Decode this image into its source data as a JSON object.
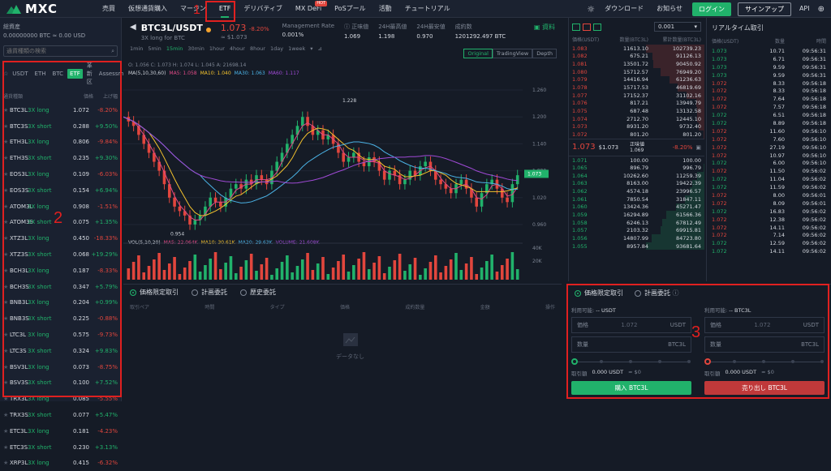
{
  "nav": {
    "logo": "MXC",
    "items": [
      "売買",
      "仮想通貨購入",
      "マージン",
      "ETF",
      "デリバティブ",
      "MX DeFi",
      "PoSプール",
      "活動",
      "チュートリアル"
    ],
    "hot_badge": "HOT",
    "download": "ダウンロード",
    "notice": "お知らせ",
    "login": "ログイン",
    "signup": "サインアップ",
    "api": "API"
  },
  "annotations": [
    "1",
    "2",
    "3"
  ],
  "left": {
    "account_title": "総資産",
    "account_value": "0.00000000 BTC ≈ 0.00 USD",
    "search_placeholder": "通貨種類の検索",
    "tabs": [
      "USDT",
      "ETH",
      "BTC",
      "ETF",
      "革新区",
      "Assessment"
    ],
    "col_pair": "通貨種類",
    "col_price": "価格",
    "col_change": "上げ幅",
    "coins": [
      {
        "name": "BTC3L",
        "tag": "3X long",
        "price": "1.072",
        "change": "-8.20%"
      },
      {
        "name": "BTC3S",
        "tag": "3X short",
        "price": "0.288",
        "change": "+9.50%"
      },
      {
        "name": "ETH3L",
        "tag": "3X long",
        "price": "0.806",
        "change": "-9.84%"
      },
      {
        "name": "ETH3S",
        "tag": "3X short",
        "price": "0.235",
        "change": "+9.30%"
      },
      {
        "name": "EOS3L",
        "tag": "3X long",
        "price": "0.109",
        "change": "-6.03%"
      },
      {
        "name": "EOS3S",
        "tag": "3X short",
        "price": "0.154",
        "change": "+6.94%"
      },
      {
        "name": "ATOM3L",
        "tag": "3X long",
        "price": "0.908",
        "change": "-1.51%"
      },
      {
        "name": "ATOM3S",
        "tag": "3X short",
        "price": "0.075",
        "change": "+1.35%"
      },
      {
        "name": "XTZ3L",
        "tag": "3X long",
        "price": "0.450",
        "change": "-18.33%"
      },
      {
        "name": "XTZ3S",
        "tag": "3X short",
        "price": "0.068",
        "change": "+19.29%"
      },
      {
        "name": "BCH3L",
        "tag": "3X long",
        "price": "0.187",
        "change": "-8.33%"
      },
      {
        "name": "BCH3S",
        "tag": "3X short",
        "price": "0.347",
        "change": "+5.79%"
      },
      {
        "name": "BNB3L",
        "tag": "3X long",
        "price": "0.204",
        "change": "+0.99%"
      },
      {
        "name": "BNB3S",
        "tag": "3X short",
        "price": "0.225",
        "change": "-0.88%"
      },
      {
        "name": "LTC3L",
        "tag": "3X long",
        "price": "0.575",
        "change": "-9.73%"
      },
      {
        "name": "LTC3S",
        "tag": "3X short",
        "price": "0.324",
        "change": "+9.83%"
      },
      {
        "name": "BSV3L",
        "tag": "3X long",
        "price": "0.073",
        "change": "-8.75%"
      },
      {
        "name": "BSV3S",
        "tag": "3X short",
        "price": "0.100",
        "change": "+7.52%"
      },
      {
        "name": "TRX3L",
        "tag": "3X long",
        "price": "0.085",
        "change": "-5.55%"
      },
      {
        "name": "TRX3S",
        "tag": "3X short",
        "price": "0.077",
        "change": "+5.47%"
      },
      {
        "name": "ETC3L",
        "tag": "3X long",
        "price": "0.181",
        "change": "-4.23%"
      },
      {
        "name": "ETC3S",
        "tag": "3X short",
        "price": "0.230",
        "change": "+3.13%"
      },
      {
        "name": "XRP3L",
        "tag": "3X long",
        "price": "0.415",
        "change": "-6.32%"
      }
    ]
  },
  "chart": {
    "pair": "BTC3L/USDT",
    "subtitle": "3X long for BTC",
    "price": "1.073",
    "change": "-8.20%",
    "price_usd": "≈ $1.073",
    "stats": [
      {
        "k": "Management Rate",
        "v": "0.001%"
      },
      {
        "k": "ⓘ 正味値",
        "v": "1.069"
      },
      {
        "k": "24H最高値",
        "v": "1.198"
      },
      {
        "k": "24H最安値",
        "v": "0.970"
      },
      {
        "k": "成約数",
        "v": "1201292.497 BTC"
      }
    ],
    "doc_link": "資料",
    "intervals": [
      "1min",
      "5min",
      "15min",
      "30min",
      "1hour",
      "4hour",
      "8hour",
      "1day",
      "1week"
    ],
    "views": [
      "Original",
      "TradingView",
      "Depth"
    ],
    "ohlc": "O: 1.056  C: 1.073  H: 1.074  L: 1.045  A: 21698.14",
    "ma_line": {
      "ma": "MA(5,10,30,60)",
      "ma5": "MA5: 1.058",
      "ma10": "MA10: 1.040",
      "ma30": "MA30: 1.063",
      "ma60": "MA60: 1.117"
    },
    "vol_line": {
      "vol": "VOL(5,10,20)",
      "ma5": "MA5: 22.064K",
      "ma10": "MA10: 30.61K",
      "ma20": "MA20: 29.63K",
      "volume": "VOLUME: 21.608K"
    },
    "y_ticks": [
      "1.260",
      "1.200",
      "1.140",
      "1.080",
      "1.020",
      "0.960"
    ],
    "vol_ticks": [
      "40K",
      "20K"
    ],
    "x_ticks": [
      "04:00",
      "16:00",
      "19:00",
      "01-17",
      "05:00"
    ],
    "high_label": "1.228",
    "low_label": "0.954",
    "last_label": "1.073"
  },
  "orders": {
    "tab_open": "価格限定取引",
    "tab_plan": "計画委託",
    "tab_history": "歴史委託",
    "cols": [
      "取引ペア",
      "時間",
      "タイプ",
      "価格",
      "成約数量",
      "金額",
      "操作"
    ],
    "empty": "データなし"
  },
  "orderbook": {
    "precision": "0.001",
    "cols": [
      "価格(USDT)",
      "数量(BTC3L)",
      "累計数量(BTC3L)"
    ],
    "asks": [
      {
        "p": "1.083",
        "a": "11613.10",
        "t": "102739.23"
      },
      {
        "p": "1.082",
        "a": "675.21",
        "t": "91126.13"
      },
      {
        "p": "1.081",
        "a": "13501.72",
        "t": "90450.92"
      },
      {
        "p": "1.080",
        "a": "15712.57",
        "t": "76949.20"
      },
      {
        "p": "1.079",
        "a": "14416.94",
        "t": "61236.63"
      },
      {
        "p": "1.078",
        "a": "15717.53",
        "t": "46819.69"
      },
      {
        "p": "1.077",
        "a": "17152.37",
        "t": "31102.16"
      },
      {
        "p": "1.076",
        "a": "817.21",
        "t": "13949.79"
      },
      {
        "p": "1.075",
        "a": "687.48",
        "t": "13132.58"
      },
      {
        "p": "1.074",
        "a": "2712.70",
        "t": "12445.10"
      },
      {
        "p": "1.073",
        "a": "8931.20",
        "t": "9732.40"
      },
      {
        "p": "1.072",
        "a": "801.20",
        "t": "801.20"
      }
    ],
    "mid_price": "1.073",
    "mid_usd": "$1.073",
    "mid_label": "正味値",
    "mid_net": "1.069",
    "mid_change": "-8.20%",
    "bids": [
      {
        "p": "1.071",
        "a": "100.00",
        "t": "100.00"
      },
      {
        "p": "1.065",
        "a": "896.79",
        "t": "996.79"
      },
      {
        "p": "1.064",
        "a": "10262.60",
        "t": "11259.39"
      },
      {
        "p": "1.063",
        "a": "8163.00",
        "t": "19422.39"
      },
      {
        "p": "1.062",
        "a": "4574.18",
        "t": "23996.57"
      },
      {
        "p": "1.061",
        "a": "7850.54",
        "t": "31847.11"
      },
      {
        "p": "1.060",
        "a": "13424.36",
        "t": "45271.47"
      },
      {
        "p": "1.059",
        "a": "16294.89",
        "t": "61566.36"
      },
      {
        "p": "1.058",
        "a": "6246.13",
        "t": "67812.49"
      },
      {
        "p": "1.057",
        "a": "2103.32",
        "t": "69915.81"
      },
      {
        "p": "1.056",
        "a": "14807.99",
        "t": "84723.80"
      },
      {
        "p": "1.055",
        "a": "8957.84",
        "t": "93681.64"
      }
    ]
  },
  "trades": {
    "title": "リアルタイム取引",
    "cols": [
      "価格(USDT)",
      "数量",
      "時間"
    ],
    "rows": [
      {
        "p": "1.073",
        "a": "10.71",
        "t": "09:56:31",
        "s": "g"
      },
      {
        "p": "1.073",
        "a": "6.71",
        "t": "09:56:31",
        "s": "g"
      },
      {
        "p": "1.073",
        "a": "9.59",
        "t": "09:56:31",
        "s": "g"
      },
      {
        "p": "1.073",
        "a": "9.59",
        "t": "09:56:31",
        "s": "g"
      },
      {
        "p": "1.072",
        "a": "8.33",
        "t": "09:56:18",
        "s": "r"
      },
      {
        "p": "1.072",
        "a": "8.33",
        "t": "09:56:18",
        "s": "r"
      },
      {
        "p": "1.072",
        "a": "7.64",
        "t": "09:56:18",
        "s": "r"
      },
      {
        "p": "1.072",
        "a": "7.57",
        "t": "09:56:18",
        "s": "r"
      },
      {
        "p": "1.072",
        "a": "6.51",
        "t": "09:56:18",
        "s": "g"
      },
      {
        "p": "1.072",
        "a": "8.89",
        "t": "09:56:18",
        "s": "g"
      },
      {
        "p": "1.072",
        "a": "11.60",
        "t": "09:56:10",
        "s": "r"
      },
      {
        "p": "1.072",
        "a": "7.60",
        "t": "09:56:10",
        "s": "r"
      },
      {
        "p": "1.072",
        "a": "27.19",
        "t": "09:56:10",
        "s": "r"
      },
      {
        "p": "1.072",
        "a": "10.97",
        "t": "09:56:10",
        "s": "r"
      },
      {
        "p": "1.072",
        "a": "6.00",
        "t": "09:56:10",
        "s": "g"
      },
      {
        "p": "1.072",
        "a": "11.50",
        "t": "09:56:02",
        "s": "r"
      },
      {
        "p": "1.072",
        "a": "11.04",
        "t": "09:56:02",
        "s": "g"
      },
      {
        "p": "1.072",
        "a": "11.59",
        "t": "09:56:02",
        "s": "g"
      },
      {
        "p": "1.072",
        "a": "8.00",
        "t": "09:56:01",
        "s": "r"
      },
      {
        "p": "1.072",
        "a": "8.09",
        "t": "09:56:01",
        "s": "r"
      },
      {
        "p": "1.072",
        "a": "16.83",
        "t": "09:56:02",
        "s": "g"
      },
      {
        "p": "1.072",
        "a": "12.38",
        "t": "09:56:02",
        "s": "r"
      },
      {
        "p": "1.072",
        "a": "14.11",
        "t": "09:56:02",
        "s": "r"
      },
      {
        "p": "1.072",
        "a": "7.14",
        "t": "09:56:02",
        "s": "r"
      },
      {
        "p": "1.072",
        "a": "12.59",
        "t": "09:56:02",
        "s": "g"
      },
      {
        "p": "1.072",
        "a": "14.11",
        "t": "09:56:02",
        "s": "g"
      }
    ]
  },
  "tradeform": {
    "tab_limit": "価格限定取引",
    "tab_plan": "計画委託",
    "avail_label": "利用可能:",
    "buy_avail": "-- USDT",
    "sell_avail": "-- BTC3L",
    "price_label": "価格",
    "price_value": "1.072",
    "price_unit": "USDT",
    "qty_label": "数量",
    "qty_unit": "BTC3L",
    "total_label": "取引額",
    "total_value": "0.000 USDT",
    "total_usd": "≈ $0",
    "buy_btn": "購入 BTC3L",
    "sell_btn": "売り出し BTC3L"
  }
}
